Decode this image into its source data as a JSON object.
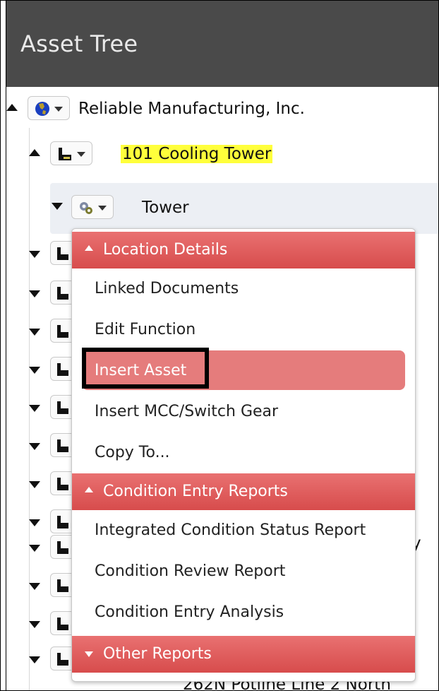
{
  "header": {
    "title": "Asset Tree"
  },
  "tree": {
    "root": {
      "label": "Reliable Manufacturing, Inc.",
      "icon": "globe-icon"
    },
    "child": {
      "label": "101 Cooling Tower",
      "icon": "factory-icon",
      "highlight_color": "#ffff3b"
    },
    "grandchild": {
      "label": "Tower",
      "icon": "gears-icon"
    },
    "partial_row_text": "262N Potline Line 2 North",
    "right_fragment": "y"
  },
  "menu": {
    "sections": [
      {
        "label": "Location Details",
        "state": "expanded"
      },
      {
        "label": "Condition Entry Reports",
        "state": "expanded"
      },
      {
        "label": "Other Reports",
        "state": "collapsed"
      }
    ],
    "location_items": [
      "Linked Documents",
      "Edit Function",
      "Insert Asset",
      "Insert MCC/Switch Gear",
      "Copy To..."
    ],
    "condition_items": [
      "Integrated Condition Status Report",
      "Condition Review Report",
      "Condition Entry Analysis"
    ],
    "active_item": "Insert Asset",
    "accent": "#e57c7c"
  }
}
